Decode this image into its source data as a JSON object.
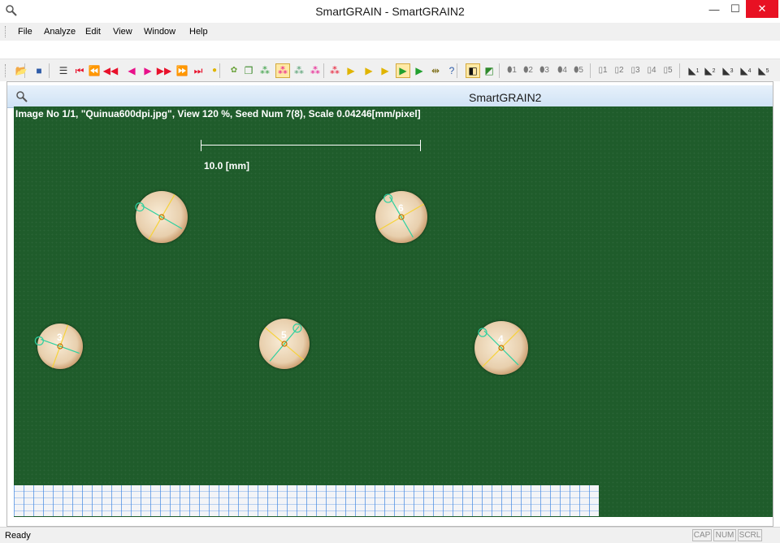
{
  "window": {
    "title": "SmartGRAIN - SmartGRAIN2",
    "minimize_glyph": "—",
    "maximize_glyph": "☐",
    "close_glyph": "✕"
  },
  "menu": [
    "File",
    "Analyze",
    "Edit",
    "View",
    "Window",
    "Help"
  ],
  "toolbar": {
    "buttons": [
      {
        "name": "open-icon",
        "glyph": "📂",
        "color": "#d8a31f"
      },
      {
        "name": "save-icon",
        "glyph": "■",
        "color": "#2f5ca8"
      },
      {
        "name": "list-icon",
        "glyph": "☰",
        "color": "#333333"
      },
      {
        "name": "first-image-icon",
        "glyph": "⏮",
        "color": "#e8102a"
      },
      {
        "name": "rewind-fast-icon",
        "glyph": "⏪",
        "color": "#e8102a"
      },
      {
        "name": "rewind-icon",
        "glyph": "◀◀",
        "color": "#e8102a"
      },
      {
        "name": "prev-icon",
        "glyph": "◀",
        "color": "#e8108a"
      },
      {
        "name": "next-icon",
        "glyph": "▶",
        "color": "#e8108a"
      },
      {
        "name": "forward-icon",
        "glyph": "▶▶",
        "color": "#e8102a"
      },
      {
        "name": "forward-fast-icon",
        "glyph": "⏩",
        "color": "#e8102a"
      },
      {
        "name": "last-image-icon",
        "glyph": "⏭",
        "color": "#e8102a"
      },
      {
        "name": "seed-icon",
        "glyph": "●",
        "color": "#e0b400"
      },
      {
        "name": "seed-select-icon",
        "glyph": "✿",
        "color": "#6aa23a"
      },
      {
        "name": "copy-icon",
        "glyph": "❐",
        "color": "#3d8a2c"
      },
      {
        "name": "seeds-green-icon",
        "glyph": "⁂",
        "color": "#2f9b3a"
      },
      {
        "name": "seeds-red-icon",
        "glyph": "⁂",
        "color": "#e8108a",
        "pressed": true
      },
      {
        "name": "seeds-mixed-icon",
        "glyph": "⁂",
        "color": "#4a9b6a"
      },
      {
        "name": "seeds-pink-icon",
        "glyph": "⁂",
        "color": "#e8108a"
      },
      {
        "name": "seeds-red2-icon",
        "glyph": "⁂",
        "color": "#e8102a"
      },
      {
        "name": "play-yellow-icon",
        "glyph": "▶",
        "color": "#e0b400"
      },
      {
        "name": "play-yellow2-icon",
        "glyph": "▶",
        "color": "#e0b400"
      },
      {
        "name": "play-yellow3-icon",
        "glyph": "▶",
        "color": "#e0b400"
      },
      {
        "name": "play-green-pressed-icon",
        "glyph": "▶",
        "color": "#22a02f",
        "pressed": true
      },
      {
        "name": "play-green-icon",
        "glyph": "▶",
        "color": "#22a02f"
      },
      {
        "name": "measure-icon",
        "glyph": "⇹",
        "color": "#7a6a10"
      },
      {
        "name": "help-icon",
        "glyph": "?",
        "color": "#2f5ca8"
      },
      {
        "name": "black-square-icon",
        "glyph": "◧",
        "color": "#111111",
        "pressed": true
      },
      {
        "name": "color-square-icon",
        "glyph": "◩",
        "color": "#2f8a2c"
      },
      {
        "name": "seed-1-icon",
        "glyph": "⬮1",
        "color": "#777777"
      },
      {
        "name": "seed-2-icon",
        "glyph": "⬮2",
        "color": "#777777"
      },
      {
        "name": "seed-3-icon",
        "glyph": "⬮3",
        "color": "#777777"
      },
      {
        "name": "seed-4-icon",
        "glyph": "⬮4",
        "color": "#777777"
      },
      {
        "name": "seed-5-icon",
        "glyph": "⬮5",
        "color": "#777777"
      },
      {
        "name": "box-1-icon",
        "glyph": "▯1",
        "color": "#777777"
      },
      {
        "name": "box-2-icon",
        "glyph": "▯2",
        "color": "#777777"
      },
      {
        "name": "box-3-icon",
        "glyph": "▯3",
        "color": "#777777"
      },
      {
        "name": "box-4-icon",
        "glyph": "▯4",
        "color": "#777777"
      },
      {
        "name": "box-5-icon",
        "glyph": "▯5",
        "color": "#777777"
      },
      {
        "name": "corner-1-icon",
        "glyph": "◣",
        "color": "#333333",
        "sup": "1"
      },
      {
        "name": "corner-2-icon",
        "glyph": "◣",
        "color": "#333333",
        "sup": "2"
      },
      {
        "name": "corner-3-icon",
        "glyph": "◣",
        "color": "#333333",
        "sup": "3"
      },
      {
        "name": "corner-4-icon",
        "glyph": "◣",
        "color": "#333333",
        "sup": "4"
      },
      {
        "name": "corner-5-icon",
        "glyph": "◣",
        "color": "#333333",
        "sup": "5"
      }
    ]
  },
  "child_window": {
    "title": "SmartGRAIN2",
    "info": "Image No 1/1, \"Quinua600dpi.jpg\", View 120 %, Seed Num 7(8), Scale 0.04246[mm/pixel]",
    "scale_label": "10.0 [mm]"
  },
  "seeds": [
    {
      "label": "",
      "color": "#f6d23a"
    },
    {
      "label": "6",
      "color": "#f6d23a"
    },
    {
      "label": "3",
      "color": "#f6d23a"
    },
    {
      "label": "5",
      "color": "#f6d23a"
    },
    {
      "label": "4",
      "color": "#f6d23a"
    }
  ],
  "status": {
    "text": "Ready",
    "indicators": [
      "CAP",
      "NUM",
      "SCRL"
    ]
  }
}
